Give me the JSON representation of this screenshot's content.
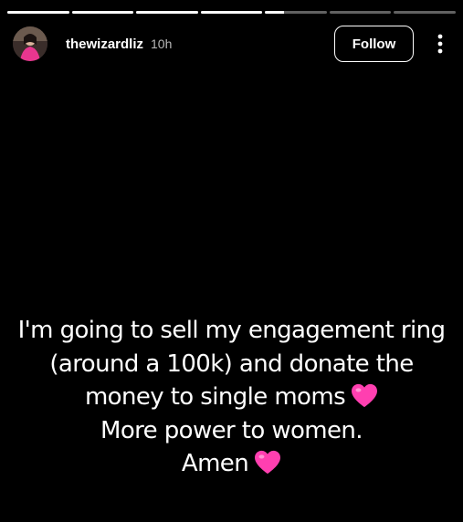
{
  "story": {
    "segments": [
      {
        "progress": 1
      },
      {
        "progress": 1
      },
      {
        "progress": 1
      },
      {
        "progress": 1
      },
      {
        "progress": 0.3
      },
      {
        "progress": 0
      },
      {
        "progress": 0
      }
    ]
  },
  "header": {
    "username": "thewizardliz",
    "timestamp": "10h",
    "follow_label": "Follow",
    "more_icon": "more-vertical-icon"
  },
  "caption": {
    "lines": [
      "I'm going to sell my engagement ring",
      "(around a 100k) and donate the",
      "money to single moms",
      "More power to women.",
      "Amen"
    ],
    "heart_color": "#ff3fb0"
  }
}
